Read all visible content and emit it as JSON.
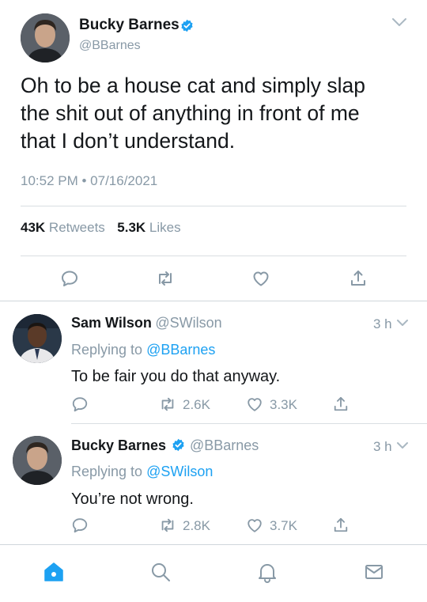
{
  "main_tweet": {
    "author_name": "Bucky Barnes",
    "author_handle": "@BBarnes",
    "text": "Oh to be a house cat and simply slap the shit out of anything in front of me that I don’t understand.",
    "timestamp": "10:52 PM • 07/16/2021",
    "retweets_count": "43K",
    "retweets_label": "Retweets",
    "likes_count": "5.3K",
    "likes_label": "Likes"
  },
  "replies": [
    {
      "author_name": "Sam Wilson",
      "author_handle": "@SWilson",
      "time": "3 h",
      "replying_prefix": "Replying to",
      "replying_to": "@BBarnes",
      "text": "To be fair you do that anyway.",
      "retweets": "2.6K",
      "likes": "3.3K"
    },
    {
      "author_name": "Bucky Barnes",
      "author_handle": "@BBarnes",
      "time": "3 h",
      "replying_prefix": "Replying to",
      "replying_to": "@SWilson",
      "text": "You’re not wrong.",
      "retweets": "2.8K",
      "likes": "3.7K"
    }
  ],
  "icons": {
    "verified": "verified-badge-icon",
    "chevron": "chevron-down-icon",
    "reply": "reply-icon",
    "retweet": "retweet-icon",
    "like": "heart-icon",
    "share": "share-icon",
    "home": "home-icon",
    "search": "search-icon",
    "notifications": "bell-icon",
    "messages": "mail-icon"
  },
  "colors": {
    "accent": "#1da1f2",
    "muted": "#8899a6",
    "text": "#14171a"
  }
}
